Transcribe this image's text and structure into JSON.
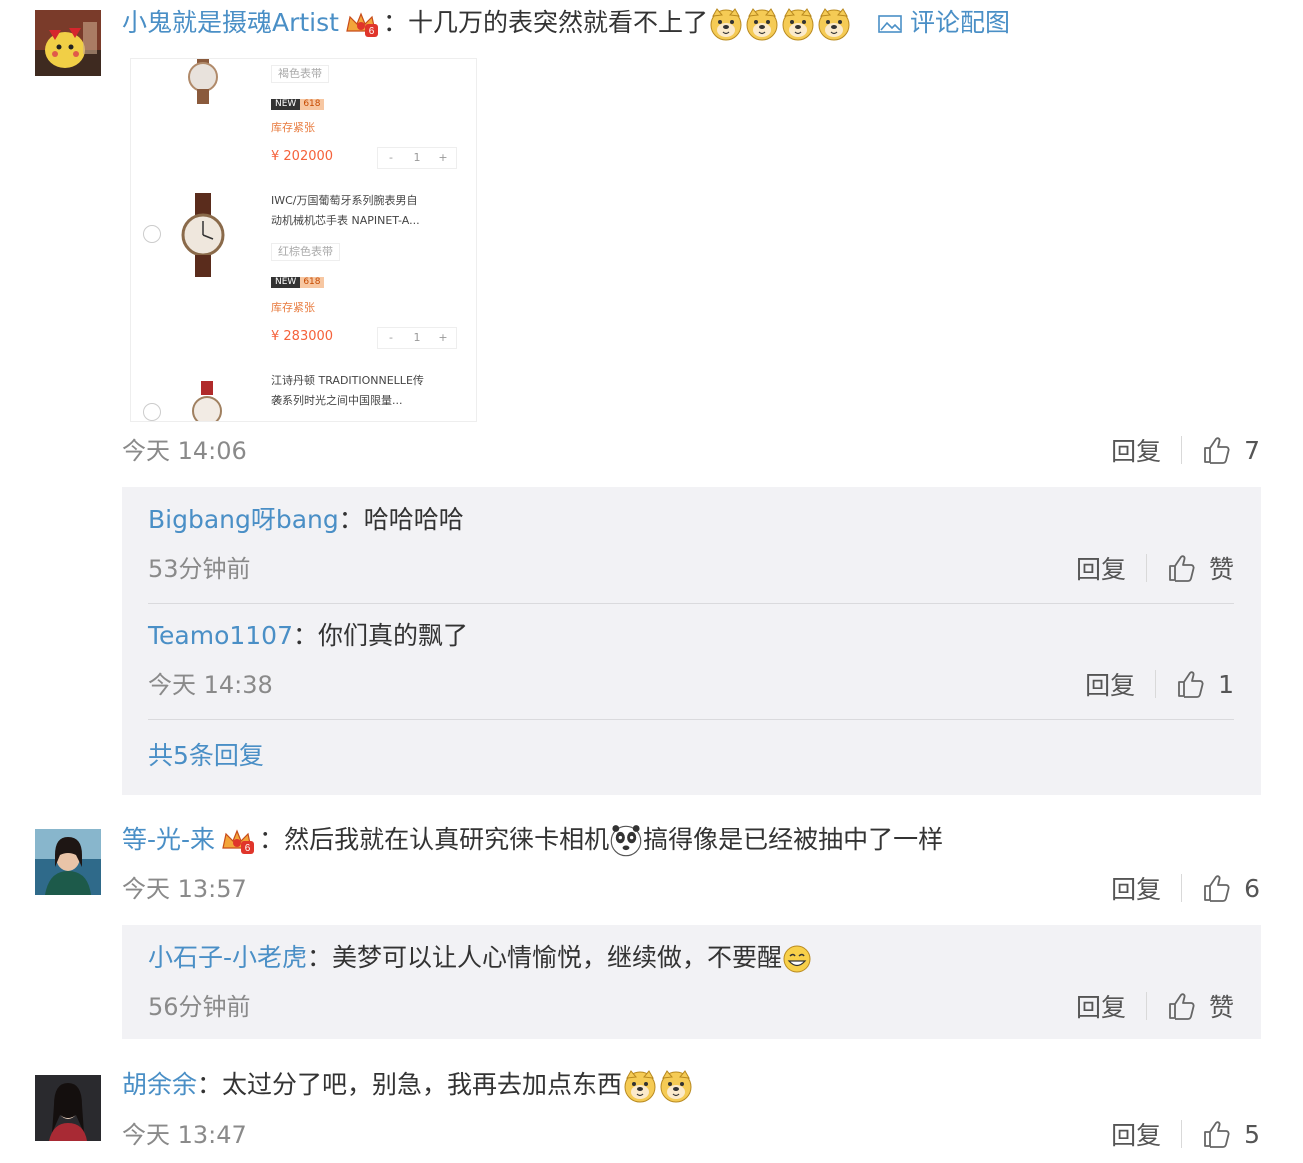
{
  "action_labels": {
    "reply": "回复"
  },
  "comment_image_link": "评论配图",
  "comments": [
    {
      "user": "小鬼就是摄魂Artist",
      "text": "十几万的表突然就看不上了",
      "time": "今天 14:06",
      "likes": "7",
      "replies": [
        {
          "user": "Bigbang呀bang",
          "text": "哈哈哈哈",
          "time": "53分钟前",
          "likes": "赞"
        },
        {
          "user": "Teamo1107",
          "text": "你们真的飘了",
          "time": "今天 14:38",
          "likes": "1"
        }
      ],
      "more_replies": "共5条回复"
    },
    {
      "user": "等-光-来",
      "text_a": "然后我就在认真研究徕卡相机",
      "text_b": "搞得像是已经被抽中了一样",
      "time": "今天 13:57",
      "likes": "6",
      "replies": [
        {
          "user": "小石子-小老虎",
          "text": "美梦可以让人心情愉悦，继续做，不要醒",
          "time": "56分钟前",
          "likes": "赞"
        }
      ]
    },
    {
      "user": "胡余余",
      "text": "太过分了吧，别急，我再去加点东西",
      "time": "今天 13:47",
      "likes": "5"
    }
  ],
  "product_screenshot": {
    "items": [
      {
        "spec": "褐色表带",
        "tag_a": "NEW",
        "tag_b": "618",
        "stock": "库存紧张",
        "price": "¥ 202000",
        "qty": "1"
      },
      {
        "name_line1": "IWC/万国葡萄牙系列腕表男自",
        "name_line2": "动机械机芯手表 NAPINET-A...",
        "spec": "红棕色表带",
        "tag_a": "NEW",
        "tag_b": "618",
        "stock": "库存紧张",
        "price": "¥ 283000",
        "qty": "1"
      },
      {
        "name_line1": "江诗丹顿 TRADITIONNELLE传",
        "name_line2": "袭系列时光之间中国限量..."
      }
    ],
    "qty_minus": "-",
    "qty_plus": "+"
  }
}
